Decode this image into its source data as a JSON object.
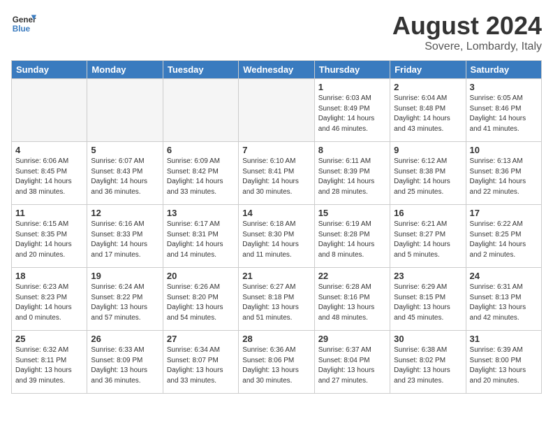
{
  "header": {
    "logo_general": "General",
    "logo_blue": "Blue",
    "title": "August 2024",
    "subtitle": "Sovere, Lombardy, Italy"
  },
  "days_of_week": [
    "Sunday",
    "Monday",
    "Tuesday",
    "Wednesday",
    "Thursday",
    "Friday",
    "Saturday"
  ],
  "weeks": [
    [
      {
        "num": "",
        "info": "",
        "empty": true
      },
      {
        "num": "",
        "info": "",
        "empty": true
      },
      {
        "num": "",
        "info": "",
        "empty": true
      },
      {
        "num": "",
        "info": "",
        "empty": true
      },
      {
        "num": "1",
        "info": "Sunrise: 6:03 AM\nSunset: 8:49 PM\nDaylight: 14 hours\nand 46 minutes.",
        "empty": false
      },
      {
        "num": "2",
        "info": "Sunrise: 6:04 AM\nSunset: 8:48 PM\nDaylight: 14 hours\nand 43 minutes.",
        "empty": false
      },
      {
        "num": "3",
        "info": "Sunrise: 6:05 AM\nSunset: 8:46 PM\nDaylight: 14 hours\nand 41 minutes.",
        "empty": false
      }
    ],
    [
      {
        "num": "4",
        "info": "Sunrise: 6:06 AM\nSunset: 8:45 PM\nDaylight: 14 hours\nand 38 minutes.",
        "empty": false
      },
      {
        "num": "5",
        "info": "Sunrise: 6:07 AM\nSunset: 8:43 PM\nDaylight: 14 hours\nand 36 minutes.",
        "empty": false
      },
      {
        "num": "6",
        "info": "Sunrise: 6:09 AM\nSunset: 8:42 PM\nDaylight: 14 hours\nand 33 minutes.",
        "empty": false
      },
      {
        "num": "7",
        "info": "Sunrise: 6:10 AM\nSunset: 8:41 PM\nDaylight: 14 hours\nand 30 minutes.",
        "empty": false
      },
      {
        "num": "8",
        "info": "Sunrise: 6:11 AM\nSunset: 8:39 PM\nDaylight: 14 hours\nand 28 minutes.",
        "empty": false
      },
      {
        "num": "9",
        "info": "Sunrise: 6:12 AM\nSunset: 8:38 PM\nDaylight: 14 hours\nand 25 minutes.",
        "empty": false
      },
      {
        "num": "10",
        "info": "Sunrise: 6:13 AM\nSunset: 8:36 PM\nDaylight: 14 hours\nand 22 minutes.",
        "empty": false
      }
    ],
    [
      {
        "num": "11",
        "info": "Sunrise: 6:15 AM\nSunset: 8:35 PM\nDaylight: 14 hours\nand 20 minutes.",
        "empty": false
      },
      {
        "num": "12",
        "info": "Sunrise: 6:16 AM\nSunset: 8:33 PM\nDaylight: 14 hours\nand 17 minutes.",
        "empty": false
      },
      {
        "num": "13",
        "info": "Sunrise: 6:17 AM\nSunset: 8:31 PM\nDaylight: 14 hours\nand 14 minutes.",
        "empty": false
      },
      {
        "num": "14",
        "info": "Sunrise: 6:18 AM\nSunset: 8:30 PM\nDaylight: 14 hours\nand 11 minutes.",
        "empty": false
      },
      {
        "num": "15",
        "info": "Sunrise: 6:19 AM\nSunset: 8:28 PM\nDaylight: 14 hours\nand 8 minutes.",
        "empty": false
      },
      {
        "num": "16",
        "info": "Sunrise: 6:21 AM\nSunset: 8:27 PM\nDaylight: 14 hours\nand 5 minutes.",
        "empty": false
      },
      {
        "num": "17",
        "info": "Sunrise: 6:22 AM\nSunset: 8:25 PM\nDaylight: 14 hours\nand 2 minutes.",
        "empty": false
      }
    ],
    [
      {
        "num": "18",
        "info": "Sunrise: 6:23 AM\nSunset: 8:23 PM\nDaylight: 14 hours\nand 0 minutes.",
        "empty": false
      },
      {
        "num": "19",
        "info": "Sunrise: 6:24 AM\nSunset: 8:22 PM\nDaylight: 13 hours\nand 57 minutes.",
        "empty": false
      },
      {
        "num": "20",
        "info": "Sunrise: 6:26 AM\nSunset: 8:20 PM\nDaylight: 13 hours\nand 54 minutes.",
        "empty": false
      },
      {
        "num": "21",
        "info": "Sunrise: 6:27 AM\nSunset: 8:18 PM\nDaylight: 13 hours\nand 51 minutes.",
        "empty": false
      },
      {
        "num": "22",
        "info": "Sunrise: 6:28 AM\nSunset: 8:16 PM\nDaylight: 13 hours\nand 48 minutes.",
        "empty": false
      },
      {
        "num": "23",
        "info": "Sunrise: 6:29 AM\nSunset: 8:15 PM\nDaylight: 13 hours\nand 45 minutes.",
        "empty": false
      },
      {
        "num": "24",
        "info": "Sunrise: 6:31 AM\nSunset: 8:13 PM\nDaylight: 13 hours\nand 42 minutes.",
        "empty": false
      }
    ],
    [
      {
        "num": "25",
        "info": "Sunrise: 6:32 AM\nSunset: 8:11 PM\nDaylight: 13 hours\nand 39 minutes.",
        "empty": false
      },
      {
        "num": "26",
        "info": "Sunrise: 6:33 AM\nSunset: 8:09 PM\nDaylight: 13 hours\nand 36 minutes.",
        "empty": false
      },
      {
        "num": "27",
        "info": "Sunrise: 6:34 AM\nSunset: 8:07 PM\nDaylight: 13 hours\nand 33 minutes.",
        "empty": false
      },
      {
        "num": "28",
        "info": "Sunrise: 6:36 AM\nSunset: 8:06 PM\nDaylight: 13 hours\nand 30 minutes.",
        "empty": false
      },
      {
        "num": "29",
        "info": "Sunrise: 6:37 AM\nSunset: 8:04 PM\nDaylight: 13 hours\nand 27 minutes.",
        "empty": false
      },
      {
        "num": "30",
        "info": "Sunrise: 6:38 AM\nSunset: 8:02 PM\nDaylight: 13 hours\nand 23 minutes.",
        "empty": false
      },
      {
        "num": "31",
        "info": "Sunrise: 6:39 AM\nSunset: 8:00 PM\nDaylight: 13 hours\nand 20 minutes.",
        "empty": false
      }
    ]
  ]
}
